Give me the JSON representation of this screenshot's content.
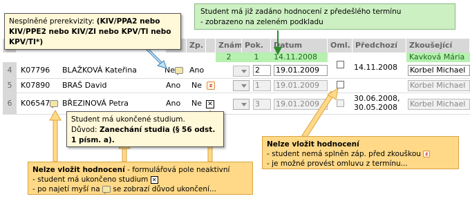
{
  "tooltip_prereq": {
    "label": "Nesplněné prerekvizity:",
    "value": "(KIV/PPA2 nebo KIV/PPE2 nebo KIV/ZI nebo KPV/TI nebo KPV/TI*)"
  },
  "callout_green": {
    "line1": "Student má již zadáno hodnocení z předešlého termínu",
    "line2": "- zobrazeno na zeleném podkladu"
  },
  "headers": {
    "col_zp": "Zp.",
    "col_znam": "Znám.",
    "col_pok": "Pok.",
    "col_datum": "Datum",
    "col_oml": "Oml.",
    "col_predchozi": "Předchozí",
    "col_zkousejici": "Zkoušející"
  },
  "prev_row": {
    "znamka": "2",
    "pokus": "1",
    "datum": "14.11.2008",
    "zkousejici": "Kavková Mária"
  },
  "rows": [
    {
      "num": "4",
      "id": "K07796",
      "name": "BLAŽKOVÁ Kateřina",
      "splneno": "Ne",
      "zp": "Ano",
      "pokus": "2",
      "datum": "19.01.2009",
      "predchozi": "14.11.2008",
      "zkousejici": "Korbel Michael"
    },
    {
      "num": "5",
      "id": "K07890",
      "name": "BRAŠ David",
      "splneno": "Ano",
      "zp": "Ne",
      "pokus": "1",
      "datum": "19.01.2009",
      "predchozi": "",
      "zkousejici": "Korbel Michael"
    },
    {
      "num": "6",
      "id": "K06547",
      "name": "BŘEZINOVÁ Petra",
      "splneno": "Ano",
      "zp": "Ne",
      "pokus": "3",
      "datum": "19.01.2009",
      "predchozi_1": "30.06.2008,",
      "predchozi_2": "30.05.2008",
      "zkousejici": "Korbel Michael"
    }
  ],
  "tooltip_study": {
    "line1": "Student má ukončené studium.",
    "reason_label": "Důvod:",
    "reason_value": "Zanechání studia (§ 56 odst. 1 písm. a)."
  },
  "callout_left": {
    "title": "Nelze vložit hodnocení",
    "title_rest": " - formulářová pole neaktivní",
    "line2": "- student má ukončeno studium",
    "line3a": "- po najetí myší na",
    "line3b": "se zobrazí důvod ukončení..."
  },
  "callout_right": {
    "title": "Nelze vložit hodnocení",
    "line2": "- student nemá splněn záp. před zkouškou",
    "line3": "- je možné provést omluvu z termínu..."
  },
  "icons": {
    "comment": "speech-bubble-icon",
    "z": "z-badge-icon",
    "x": "ended-study-icon"
  },
  "colors": {
    "green_bg": "#b7f0b0",
    "orange_bg": "#ffd987",
    "tooltip_bg": "#fff8d9"
  }
}
